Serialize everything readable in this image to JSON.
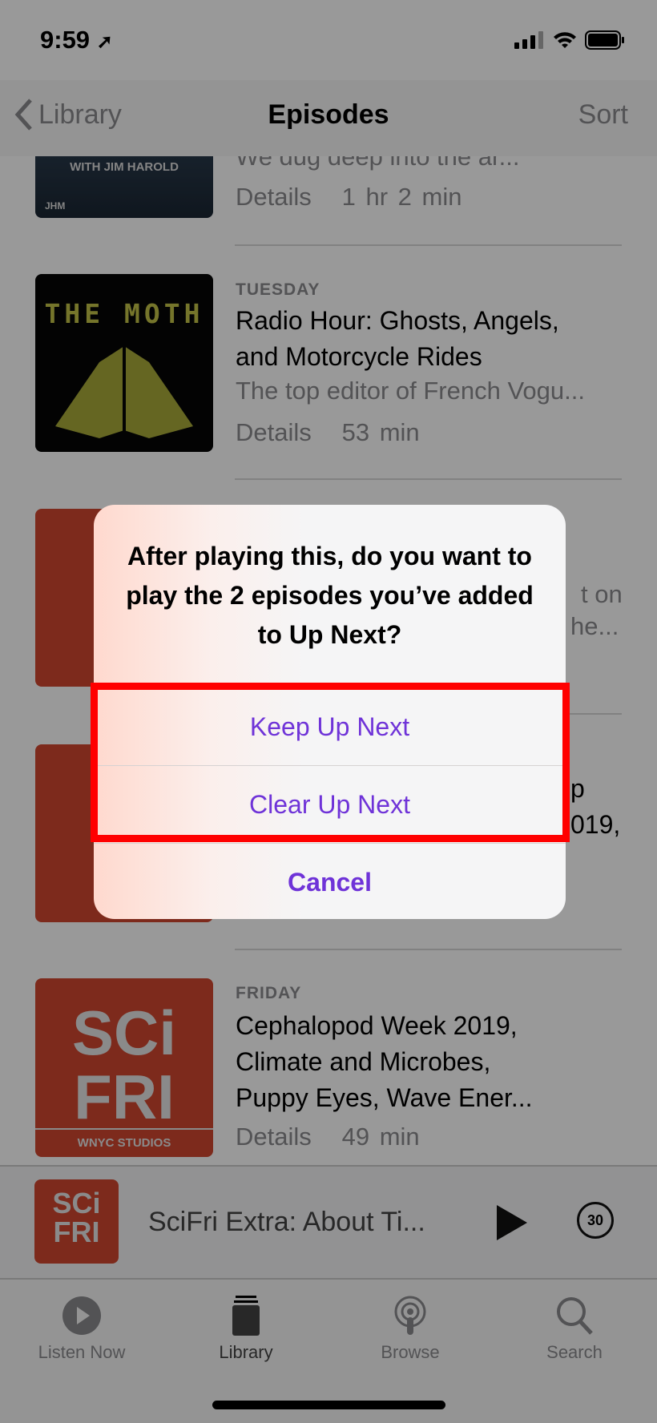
{
  "status_bar": {
    "time": "9:59",
    "location_icon": "location-arrow-icon",
    "signal_icon": "cellular-signal-icon",
    "wifi_icon": "wifi-icon",
    "battery_icon": "battery-icon"
  },
  "nav": {
    "back_label": "Library",
    "title": "Episodes",
    "sort_label": "Sort"
  },
  "episodes": [
    {
      "art": "Jim Harold podcast",
      "art_text": "WITH JIM HAROLD",
      "art_logo": "JHM",
      "day": "",
      "title": "",
      "description": "We dug deep into the ar...",
      "details": "Details",
      "duration": "1 hr 2 min"
    },
    {
      "art": "The Moth",
      "art_text": "THE MOTH",
      "day": "TUESDAY",
      "title_lines": [
        "Radio Hour: Ghosts, Angels,",
        "and Motorcycle Rides"
      ],
      "description": "The top editor of French Vogu...",
      "details": "Details",
      "duration": "53 min"
    },
    {
      "art": "SciFri",
      "visible_fragments": [
        "t on",
        "he..."
      ]
    },
    {
      "art": "SciFri",
      "visible_fragments": [
        "p",
        "019,"
      ]
    },
    {
      "art": "SciFri",
      "art_sci": "SCi",
      "art_fri": "FRI",
      "art_studio": "WNYC STUDIOS",
      "day": "FRIDAY",
      "title_lines": [
        "Cephalopod Week 2019,",
        "Climate and Microbes,",
        "Puppy Eyes, Wave Ener..."
      ],
      "details": "Details",
      "duration": "49 min"
    }
  ],
  "mini_player": {
    "title": "SciFri Extra: About Ti...",
    "play_icon": "play-icon",
    "skip_icon": "skip-forward-30-icon",
    "skip_label": "30"
  },
  "tabs": [
    {
      "label": "Listen Now",
      "icon": "play-circle-icon"
    },
    {
      "label": "Library",
      "icon": "library-icon",
      "active": true
    },
    {
      "label": "Browse",
      "icon": "podcast-icon"
    },
    {
      "label": "Search",
      "icon": "search-icon"
    }
  ],
  "alert": {
    "title": "After playing this, do you want to play the 2 episodes you’ve added to Up Next?",
    "buttons": [
      "Keep Up Next",
      "Clear Up Next"
    ],
    "cancel": "Cancel"
  },
  "colors": {
    "accent": "#6f33d8",
    "highlight": "#ff0000",
    "scifri": "#d0472f"
  }
}
